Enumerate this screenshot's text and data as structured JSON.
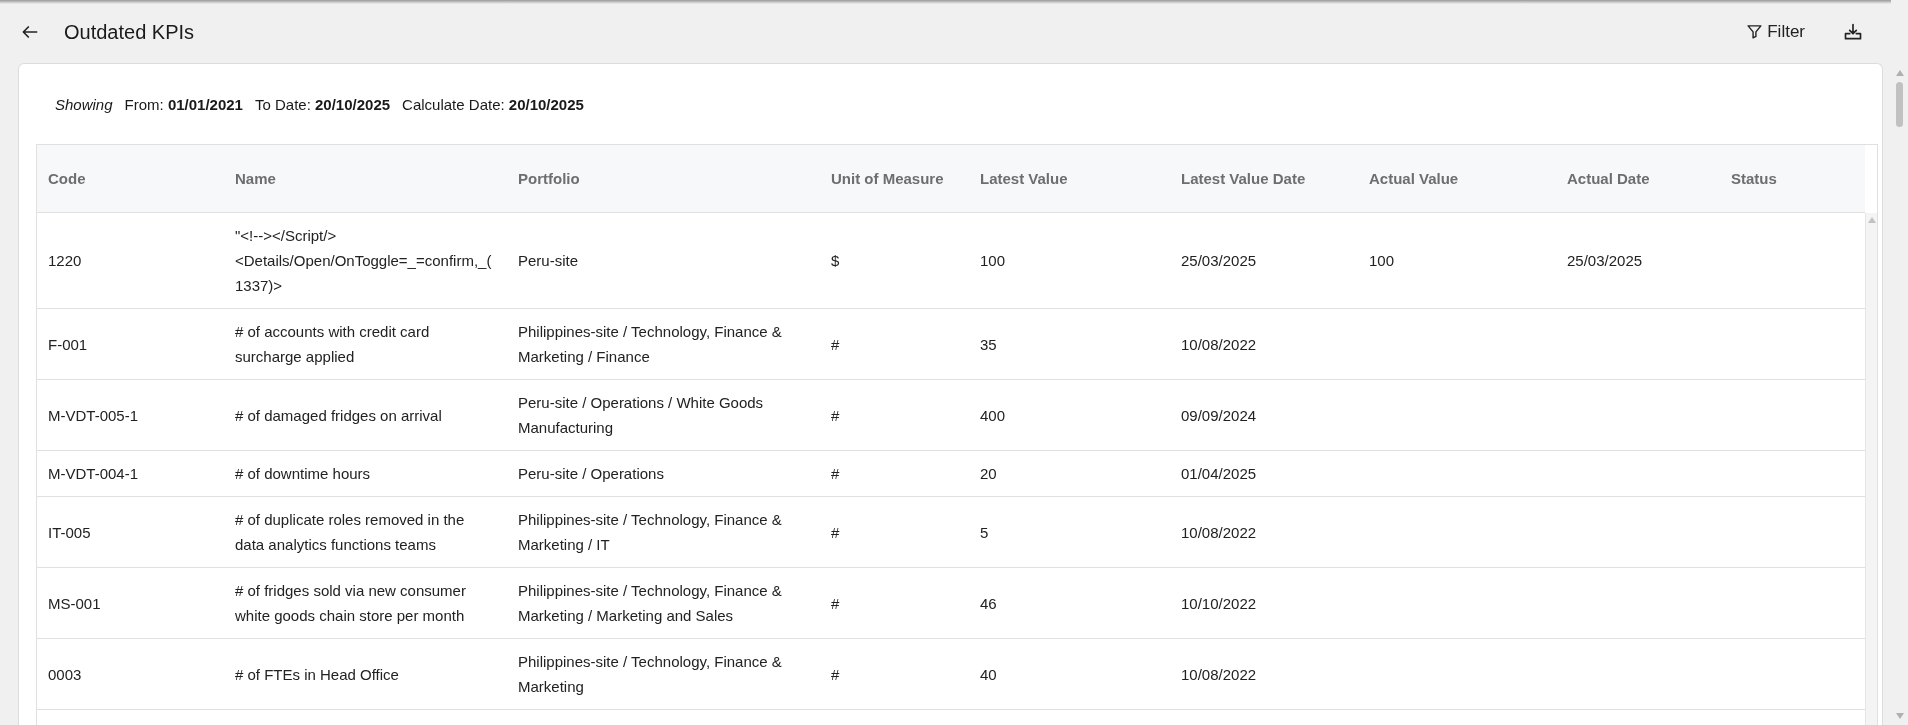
{
  "header": {
    "title": "Outdated KPIs",
    "actions": [
      {
        "kind": "filter",
        "label": "Filter"
      },
      {
        "kind": "download"
      }
    ]
  },
  "showing": {
    "label": "Showing",
    "items": [
      {
        "label": "From:",
        "value": "01/01/2021"
      },
      {
        "label": "To Date:",
        "value": "20/10/2025"
      },
      {
        "label": "Calculate Date:",
        "value": "20/10/2025"
      }
    ]
  },
  "table": {
    "columns": [
      "Code",
      "Name",
      "Portfolio",
      "Unit of Measure",
      "Latest Value",
      "Latest Value Date",
      "Actual Value",
      "Actual Date",
      "Status"
    ],
    "rows": [
      {
        "code": "1220",
        "name": "\"<!--></Script/><Details/Open/OnToggle=_=confirm,_(1337)>",
        "portfolio": "Peru-site",
        "unit": "$",
        "latest_value": "100",
        "latest_value_date": "25/03/2025",
        "actual_value": "100",
        "actual_date": "25/03/2025"
      },
      {
        "code": "F-001",
        "name": "# of accounts with credit card surcharge applied",
        "portfolio": "Philippines-site / Technology, Finance & Marketing / Finance",
        "unit": "#",
        "latest_value": "35",
        "latest_value_date": "10/08/2022"
      },
      {
        "code": "M-VDT-005-1",
        "name": "# of damaged fridges on arrival",
        "portfolio": "Peru-site / Operations / White Goods Manufacturing",
        "unit": "#",
        "latest_value": "400",
        "latest_value_date": "09/09/2024"
      },
      {
        "code": "M-VDT-004-1",
        "name": "# of downtime hours",
        "portfolio": "Peru-site / Operations",
        "unit": "#",
        "latest_value": "20",
        "latest_value_date": "01/04/2025"
      },
      {
        "code": "IT-005",
        "name": "# of duplicate roles removed in the data analytics functions teams",
        "portfolio": "Philippines-site / Technology, Finance & Marketing / IT",
        "unit": "#",
        "latest_value": "5",
        "latest_value_date": "10/08/2022"
      },
      {
        "code": "MS-001",
        "name": "# of fridges sold via new consumer white goods chain store per month",
        "portfolio": "Philippines-site / Technology, Finance & Marketing / Marketing and Sales",
        "unit": "#",
        "latest_value": "46",
        "latest_value_date": "10/10/2022"
      },
      {
        "code": "0003",
        "name": "# of FTEs in Head Office",
        "portfolio": "Philippines-site / Technology, Finance & Marketing",
        "unit": "#",
        "latest_value": "40",
        "latest_value_date": "10/08/2022"
      }
    ]
  }
}
